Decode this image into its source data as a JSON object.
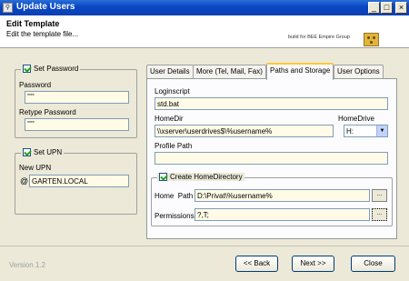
{
  "window": {
    "title": "Update Users",
    "icon": "app-icon"
  },
  "header": {
    "title": "Edit Template",
    "subtitle": "Edit the template file...",
    "brand": "build for BEE Empire Group"
  },
  "password_group": {
    "label": "Set Password",
    "checked": true,
    "password_label": "Password",
    "password_value": "****",
    "retype_label": "Retype Password",
    "retype_value": "****"
  },
  "upn_group": {
    "label": "Set UPN",
    "checked": true,
    "new_upn_label": "New UPN",
    "at": "@",
    "upn_value": "GARTEN.LOCAL"
  },
  "tabs": [
    {
      "label": "User Details",
      "active": false
    },
    {
      "label": "More (Tel, Mail, Fax)",
      "active": false
    },
    {
      "label": "Paths and Storage",
      "active": true
    },
    {
      "label": "User Options",
      "active": false
    }
  ],
  "paths": {
    "loginscript_label": "Loginscript",
    "loginscript_value": "std.bat",
    "homedir_label": "HomeDir",
    "homedir_value": "\\\\xserver\\userdrives$\\%username%",
    "homedrive_label": "HomeDrive",
    "homedrive_value": "H:",
    "profile_label": "Profile Path",
    "profile_value": ""
  },
  "homedir_group": {
    "label": "Create HomeDirectory",
    "checked": true,
    "home_path_label": "Home  Path",
    "home_path_value": "D:\\Privat\\%username%",
    "permissions_label": "Permissions:",
    "permissions_value": "?,T;",
    "browse_label": "..."
  },
  "footer": {
    "version": "Version 1.2",
    "back": "<< Back",
    "next": "Next >>",
    "close": "Close"
  }
}
